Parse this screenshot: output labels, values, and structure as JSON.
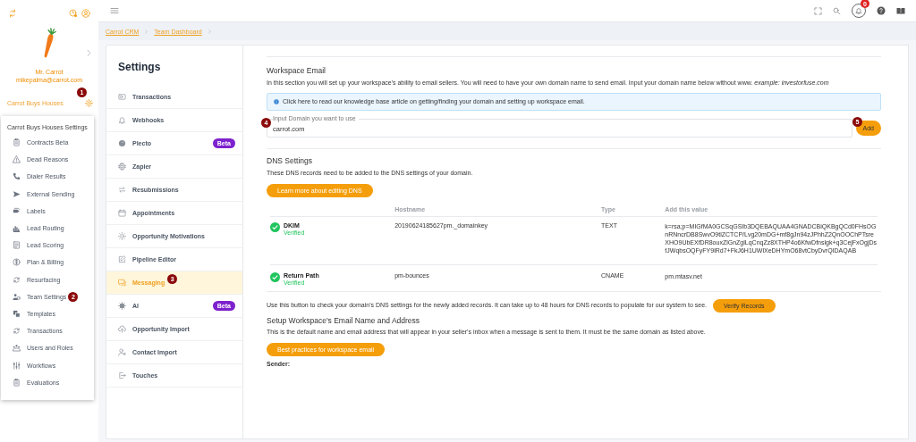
{
  "sidebar": {
    "user_name": "Mr. Carrot",
    "email": "mikepalma@carrot.com",
    "workspace": "Carrot Buys Houses",
    "workspace_badge": "1"
  },
  "settings_menu": {
    "title": "Carrot Buys Houses Settings",
    "items": [
      {
        "label": "Contracts Beta"
      },
      {
        "label": "Dead Reasons"
      },
      {
        "label": "Dialer Results"
      },
      {
        "label": "External Sending"
      },
      {
        "label": "Labels"
      },
      {
        "label": "Lead Routing"
      },
      {
        "label": "Lead Scoring"
      },
      {
        "label": "Plan & Billing"
      },
      {
        "label": "Resurfacing"
      },
      {
        "label": "Team Settings",
        "badge": "2"
      },
      {
        "label": "Templates"
      },
      {
        "label": "Transactions"
      },
      {
        "label": "Users and Roles"
      },
      {
        "label": "Workflows"
      },
      {
        "label": "Evaluations"
      }
    ]
  },
  "topbar": {
    "notification_count": "0"
  },
  "breadcrumb": [
    "Carrot CRM",
    "Team Dashboard"
  ],
  "settings": {
    "title": "Settings",
    "items": [
      {
        "label": "Transactions",
        "selected": false
      },
      {
        "label": "Webhooks",
        "selected": false
      },
      {
        "label": "Plecto",
        "selected": false,
        "tag": "Beta"
      },
      {
        "label": "Zapier",
        "selected": false
      },
      {
        "label": "Resubmissions",
        "selected": false
      },
      {
        "label": "Appointments",
        "selected": false
      },
      {
        "label": "Opportunity Motivations",
        "selected": false
      },
      {
        "label": "Pipeline Editor",
        "selected": false
      },
      {
        "label": "Messaging",
        "selected": true,
        "badge": "3"
      },
      {
        "label": "AI",
        "selected": false,
        "tag": "Beta"
      },
      {
        "label": "Opportunity Import",
        "selected": false
      },
      {
        "label": "Contact Import",
        "selected": false
      },
      {
        "label": "Touches",
        "selected": false
      }
    ]
  },
  "workspace_email": {
    "title": "Workspace Email",
    "description": "In this section you will set up your workspace's ability to email sellers. You will need to have your own domain name to send email. Input your domain name below without www. *example: investorfuse.com*",
    "info": "Click here to read our knowledge base article on getting/finding your domain and setting up workspace email.",
    "domain_field": {
      "label": "Input Domain you want to use",
      "value": "carrot.com",
      "badge": "4"
    },
    "add_button": {
      "label": "Add",
      "badge": "5"
    }
  },
  "dns": {
    "title": "DNS Settings",
    "description": "These DNS records need to be added to the DNS settings of your domain.",
    "learn_button": "Learn more about editing DNS",
    "columns": [
      "Hostname",
      "Type",
      "Add this value"
    ],
    "records": [
      {
        "name": "DKIM",
        "status": "Verified",
        "verified": true,
        "hostname": "20190624185627pm._domainkey",
        "type": "TEXT",
        "value": "k=rsa;p=MIGfMA0GCSqGSIb3DQEBAQUAA4GNADCBiQKBgQCd0FHsOGnRNncrDB8SwvO9tlZCTCP/Lvg20mDG+mf8gJn94zJPhhZ2QnOOChPTsreXHO9UbEXfDR8ouxZlGnZglLqCnqZz8XTHP4o6KfwDfnslgk+q3CejFxOgjDsfJWqbsOQFyFY9lRd7+FkJ6H1UWlXeDHYmO68vtCbyDvrQIDAQAB"
      },
      {
        "name": "Return Path",
        "status": "Verified",
        "verified": true,
        "hostname": "pm-bounces",
        "type": "CNAME",
        "value": "pm.mtasv.net"
      }
    ]
  },
  "verify": {
    "text": "Use this button to check your domain's DNS settings for the newly added records. It can take up to 48 hours for DNS records to populate for our system to see.",
    "button": "Verify Records"
  },
  "sender_setup": {
    "title": "Setup Workspace's Email Name and Address",
    "description": "This is the default name and email address that will appear in your seller's inbox when a message is sent to them. It must be the same domain as listed above.",
    "button": "Best practices for workspace email",
    "sender_label": "Sender:"
  }
}
